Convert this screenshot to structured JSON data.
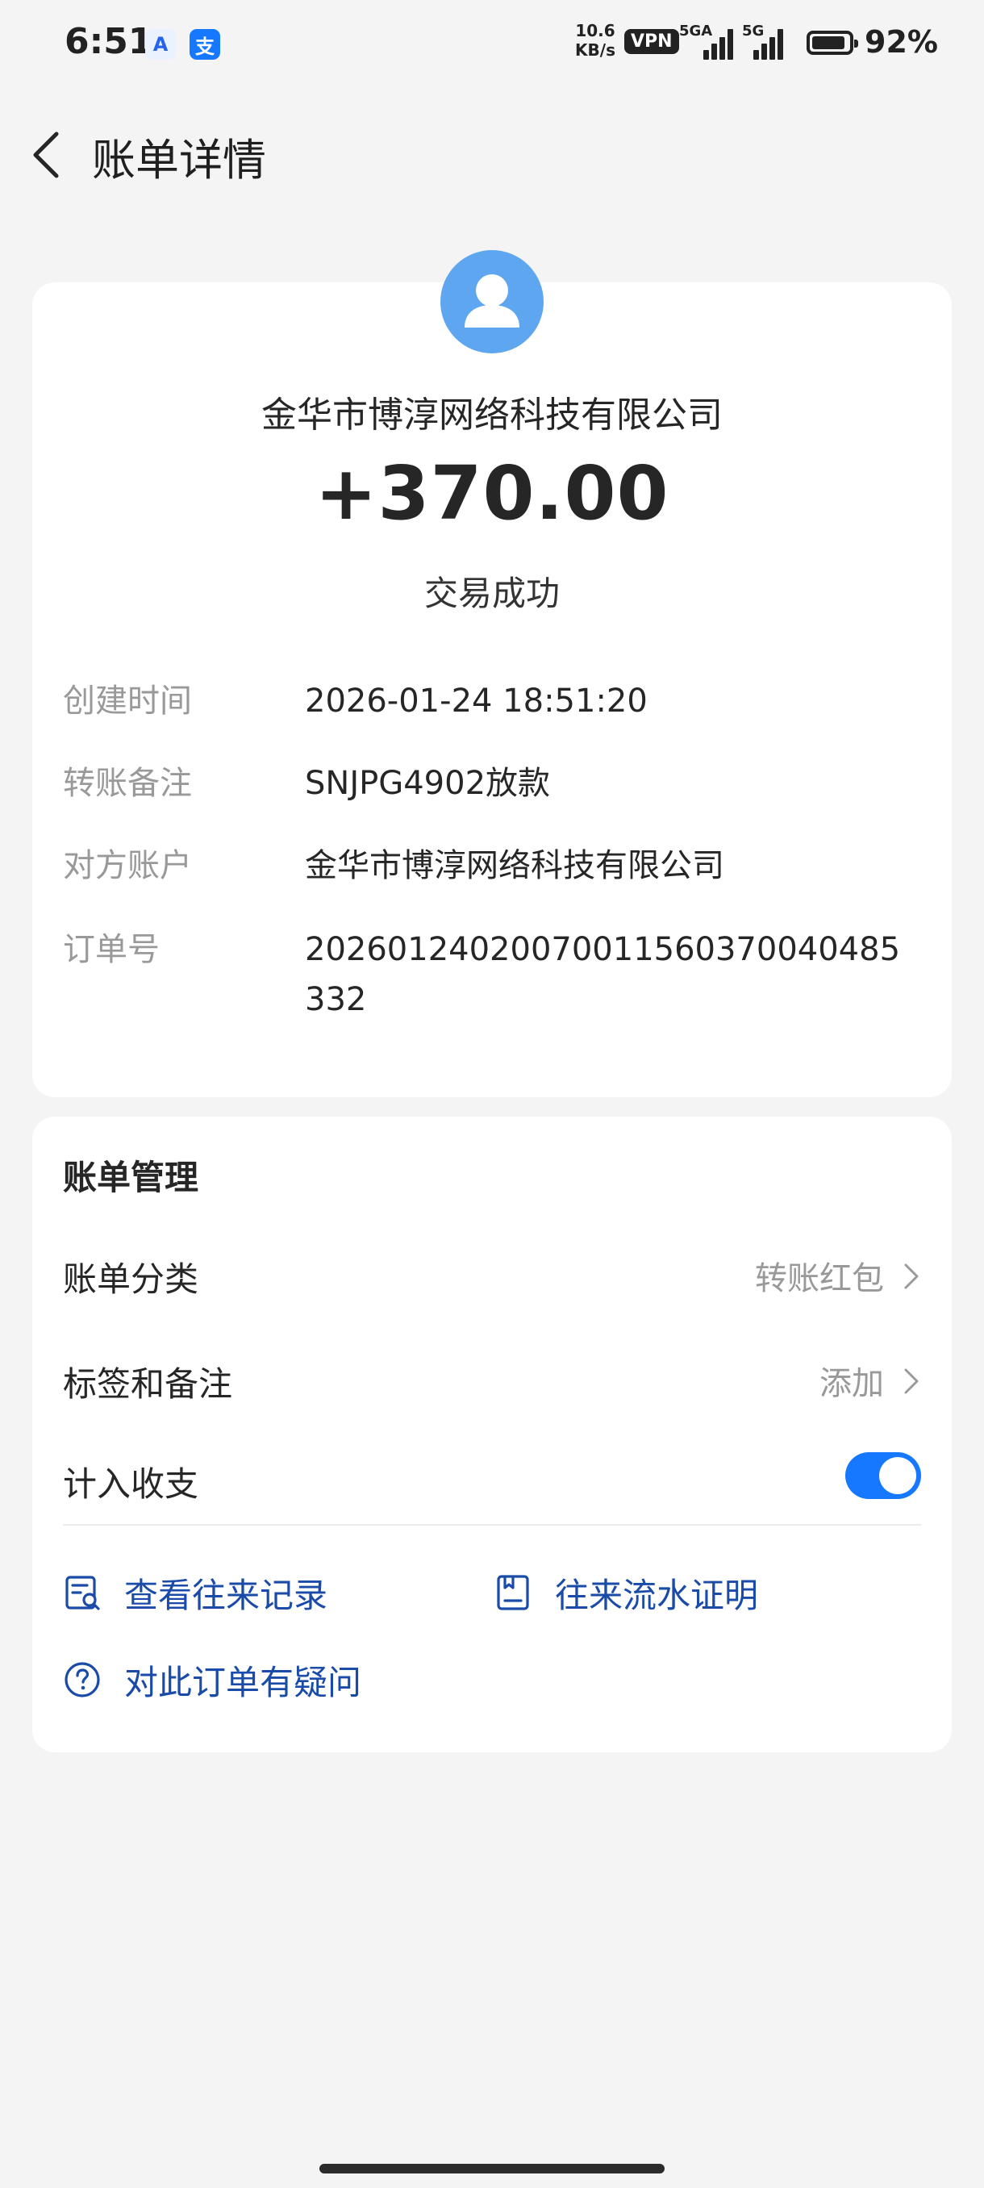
{
  "status_bar": {
    "time": "6:51",
    "app_icon_1": "A",
    "app_icon_2": "支",
    "net_speed_value": "10.6",
    "net_speed_unit": "KB/s",
    "vpn": "VPN",
    "signal_1_label": "5GA",
    "signal_2_label": "5G",
    "battery_level": 0.92,
    "battery_percent": "92%"
  },
  "header": {
    "title": "账单详情"
  },
  "transaction": {
    "counterparty": "金华市博淳网络科技有限公司",
    "amount": "+370.00",
    "status": "交易成功",
    "details": [
      {
        "label": "创建时间",
        "value": "2026-01-24 18:51:20"
      },
      {
        "label": "转账备注",
        "value": "SNJPG4902放款"
      },
      {
        "label": "对方账户",
        "value": "金华市博淳网络科技有限公司"
      },
      {
        "label": "订单号",
        "value": "20260124020070011560370040485332"
      }
    ]
  },
  "management": {
    "title": "账单管理",
    "rows": [
      {
        "label": "账单分类",
        "value": "转账红包"
      },
      {
        "label": "标签和备注",
        "value": "添加"
      },
      {
        "label": "计入收支",
        "toggle_on": true
      }
    ],
    "links": [
      {
        "label": "查看往来记录",
        "icon": "record-search-icon"
      },
      {
        "label": "往来流水证明",
        "icon": "certificate-icon"
      },
      {
        "label": "对此订单有疑问",
        "icon": "question-icon"
      }
    ]
  },
  "colors": {
    "accent": "#1677ff",
    "link": "#1a4ba8",
    "avatar": "#5ea7f0",
    "background": "#f4f4f4"
  }
}
